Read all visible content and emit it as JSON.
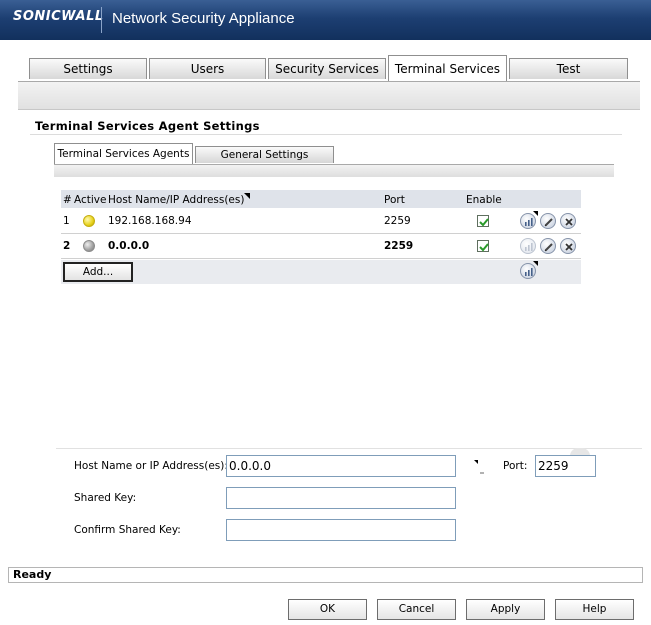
{
  "header": {
    "brand": "SONICWALL",
    "title": "Network Security Appliance"
  },
  "tabs": [
    {
      "label": "Settings"
    },
    {
      "label": "Users"
    },
    {
      "label": "Security Services"
    },
    {
      "label": "Terminal Services",
      "active": true
    },
    {
      "label": "Test"
    }
  ],
  "section": {
    "title": "Terminal Services Agent Settings"
  },
  "subtabs": [
    {
      "label": "Terminal Services Agents",
      "active": true
    },
    {
      "label": "General Settings"
    }
  ],
  "table": {
    "columns": {
      "num": "#",
      "active": "Active",
      "host": "Host Name/IP Address(es)",
      "port": "Port",
      "enable": "Enable"
    },
    "rows": [
      {
        "num": "1",
        "active": "yellow",
        "host": "192.168.168.94",
        "port": "2259",
        "enabled": true,
        "bold": false
      },
      {
        "num": "2",
        "active": "gray",
        "host": "0.0.0.0",
        "port": "2259",
        "enabled": true,
        "bold": true
      }
    ],
    "add_label": "Add..."
  },
  "form": {
    "host_label": "Host Name or IP Address(es):",
    "host_value": "0.0.0.0",
    "port_label": "Port:",
    "port_value": "2259",
    "shared_key_label": "Shared Key:",
    "shared_key_value": "",
    "confirm_key_label": "Confirm Shared Key:",
    "confirm_key_value": ""
  },
  "status": "Ready",
  "buttons": {
    "ok": "OK",
    "cancel": "Cancel",
    "apply": "Apply",
    "help": "Help"
  },
  "colors": {
    "header": "#1d3f72",
    "check": "#2a9a2a",
    "active_yellow": "#e7d21c",
    "active_gray": "#a0a0a0"
  }
}
